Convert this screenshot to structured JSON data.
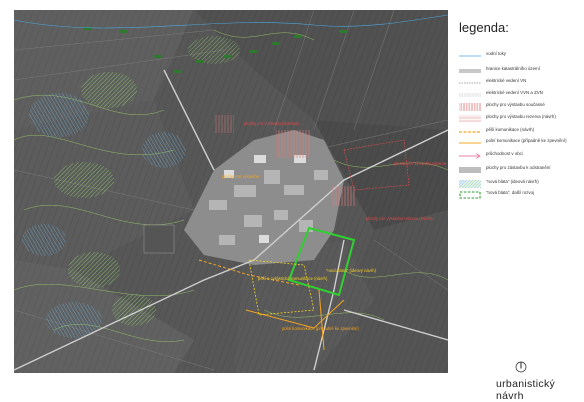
{
  "legend": {
    "title": "legenda:",
    "items": [
      {
        "label": "vodní toky",
        "symbol": "line",
        "color": "#4aa8e0"
      },
      {
        "label": "hranice katastrálního území",
        "symbol": "band",
        "color": "#c8c8c8"
      },
      {
        "label": "elektrické vedení VN",
        "symbol": "dashed",
        "color": "#8a8a8a"
      },
      {
        "label": "elektrické vedení VVN a ZVN",
        "symbol": "dotted",
        "color": "#8a8a8a"
      },
      {
        "label": "plochy pro výstavbu současné",
        "symbol": "vhatch",
        "color": "#e07a7a"
      },
      {
        "label": "plochy pro výstavbu rezerva (návrh)",
        "symbol": "hlines",
        "color": "#e3a0a0"
      },
      {
        "label": "pěší komunikace (návrh)",
        "symbol": "dashed-thick",
        "color": "#f5a623"
      },
      {
        "label": "polní komunikace (případně ke zpevnění)",
        "symbol": "line-thick",
        "color": "#f5a623"
      },
      {
        "label": "průchodnost v obci",
        "symbol": "arrow",
        "color": "#e05a8a"
      },
      {
        "label": "plochy pro zástavbu k odstranění",
        "symbol": "block",
        "color": "#bdbdbd"
      },
      {
        "label": "\"nová blata\" (ideová návrh)",
        "symbol": "hatch-blue-green",
        "color": "#8fd46a"
      },
      {
        "label": "\"nová blata\", další rozvoj",
        "symbol": "dashed-rect",
        "color": "#2f9e2f"
      }
    ]
  },
  "map_labels": [
    {
      "text": "plochy pro výstavbu (rezerva)",
      "color": "#e04a4a"
    },
    {
      "text": "plochy pro výstavbu",
      "color": "#f5a623"
    },
    {
      "text": "plochy pro výstavbu rezerva",
      "color": "#e04a4a"
    },
    {
      "text": "plochy pro výstavbu rezerva (návrh)",
      "color": "#e04a4a"
    },
    {
      "text": "pěší a cyklistická komunikace (návrh)",
      "color": "#f5d020"
    },
    {
      "text": "\"nová blata\" (ideový návrh)",
      "color": "#f5d020"
    },
    {
      "text": "polní komunikace (případně ke zpevnění)",
      "color": "#f5a623"
    }
  ],
  "title": "urbanistický návrh"
}
